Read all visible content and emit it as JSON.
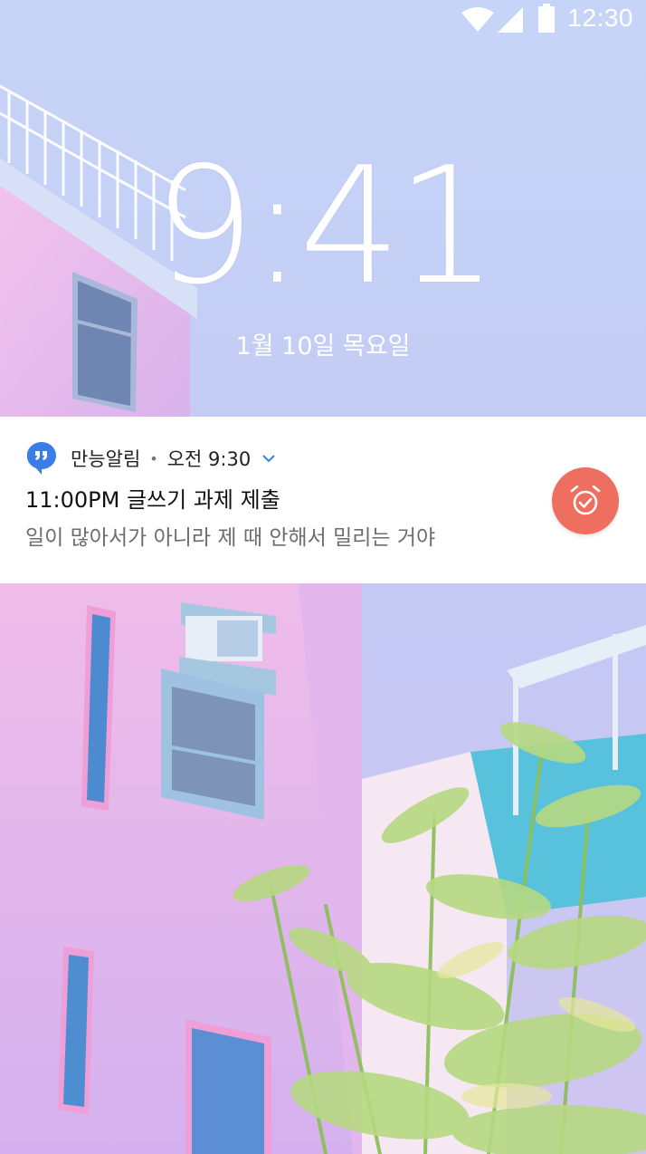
{
  "status_bar": {
    "time": "12:30",
    "icons": [
      "wifi-icon",
      "cell-signal-icon",
      "battery-icon"
    ]
  },
  "lockscreen": {
    "clock": "9:41",
    "date": "1월 10일 목요일"
  },
  "notification": {
    "app_name": "만능알림",
    "separator": "•",
    "time": "오전 9:30",
    "title": "11:00PM 글쓰기 과제 제출",
    "body": "일이 많아서가 아니라 제 때 안해서 밀리는 거야",
    "app_icon": "quote-bubble-icon",
    "action_icon": "alarm-check-icon",
    "action_color": "#ee6e60",
    "app_icon_color": "#3a7de6"
  },
  "wallpaper": {
    "description_icon": "pastel-building-photo",
    "sky_color": "#c8d1f6",
    "wall_color": "#f0b9ea"
  }
}
